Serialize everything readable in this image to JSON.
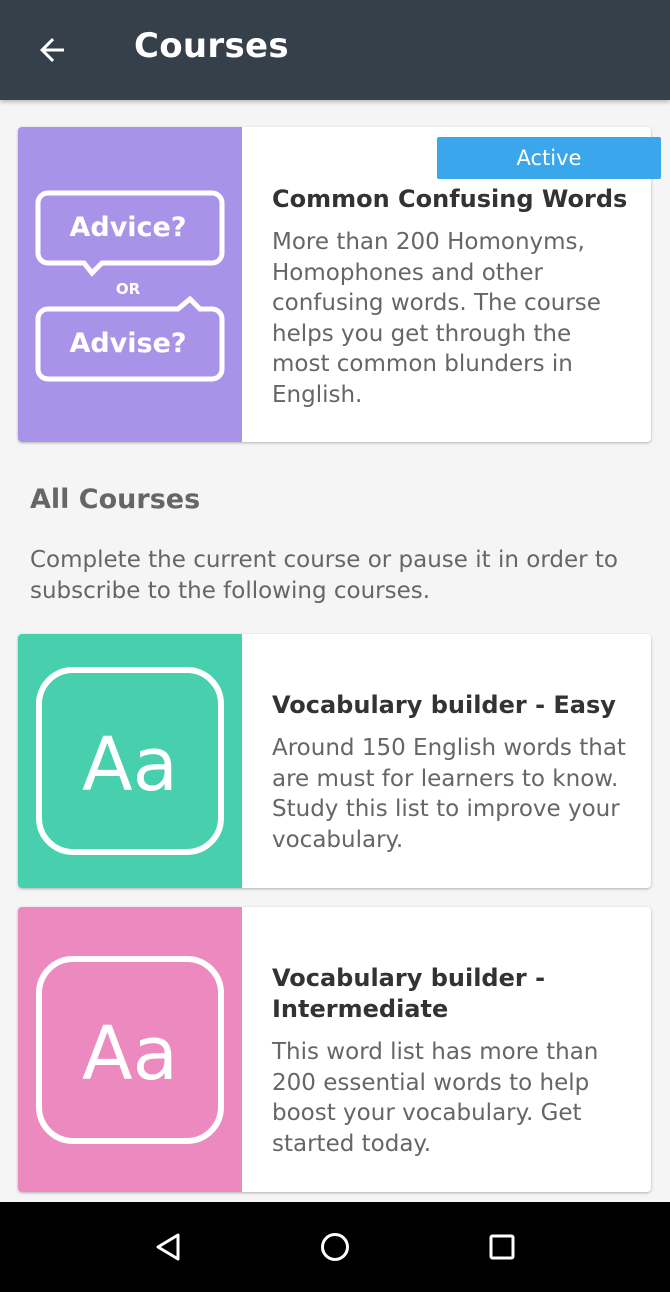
{
  "appbar": {
    "title": "Courses",
    "back_icon": "arrow-left-icon",
    "background": "#35404a"
  },
  "active_course": {
    "badge": "Active",
    "title": "Common Confusing Words",
    "description": "More than 200 Homonyms, Homophones and other confusing words. The course helps you get through the most common blunders in English.",
    "thumb_color": "#a893e8",
    "thumb_text_top": "Advice?",
    "thumb_text_mid": "OR",
    "thumb_text_bottom": "Advise?"
  },
  "all_courses": {
    "title": "All Courses",
    "description": "Complete the current course or pause it in order to subscribe to the following courses.",
    "items": [
      {
        "title": "Vocabulary builder - Easy",
        "description": "Around 150 English words that are must for learners to know. Study this list to improve your vocabulary.",
        "thumb_color": "#47cfae",
        "thumb_text": "Aa"
      },
      {
        "title": "Vocabulary builder - Intermediate",
        "description": "This word list has more than 200 essential words to help boost your vocabulary. Get started today.",
        "thumb_color": "#ec89bf",
        "thumb_text": "Aa"
      }
    ]
  },
  "navbar": {
    "back": "triangle-back-icon",
    "home": "circle-home-icon",
    "recents": "square-recents-icon"
  }
}
